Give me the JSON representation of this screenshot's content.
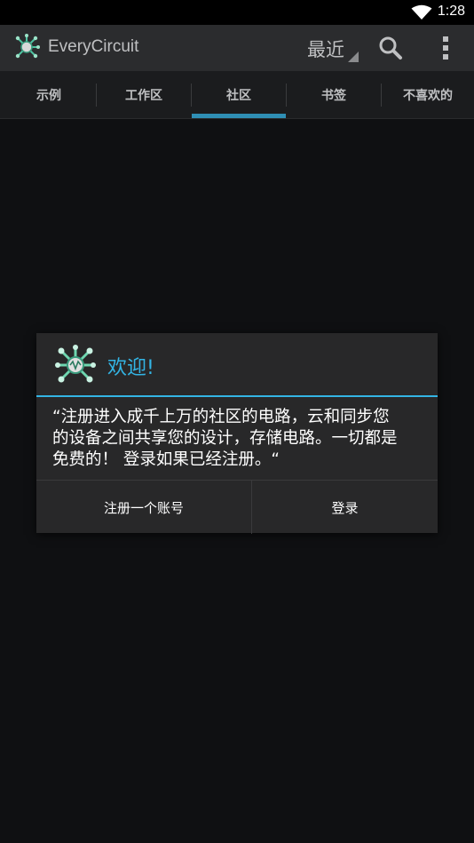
{
  "status_bar": {
    "time": "1:28",
    "wifi_icon": "wifi-icon"
  },
  "action_bar": {
    "app_title": "EveryCircuit",
    "app_icon": "everycircuit-logo-icon",
    "sort_label": "最近",
    "search_icon": "search-icon",
    "overflow_icon": "overflow-menu-icon"
  },
  "tabs": [
    {
      "label": "示例",
      "selected": false
    },
    {
      "label": "工作区",
      "selected": false
    },
    {
      "label": "社区",
      "selected": true
    },
    {
      "label": "书签",
      "selected": false
    },
    {
      "label": "不喜欢的",
      "selected": false
    }
  ],
  "dialog": {
    "title": "欢迎!",
    "icon": "everycircuit-logo-icon",
    "message_lines": [
      "“注册进入成千上万的社区的电路，云和同步您",
      "的设备之间共享您的设计，存储电路。一切都是",
      "免费的！ 登录如果已经注册。“"
    ],
    "register_button": "注册一个账号",
    "login_button": "登录"
  },
  "colors": {
    "accent": "#33b5e5",
    "tab_indicator": "#2f8fb5",
    "action_bar_bg": "#2b2c2e",
    "background": "#0f1012",
    "dialog_bg": "#282829"
  }
}
